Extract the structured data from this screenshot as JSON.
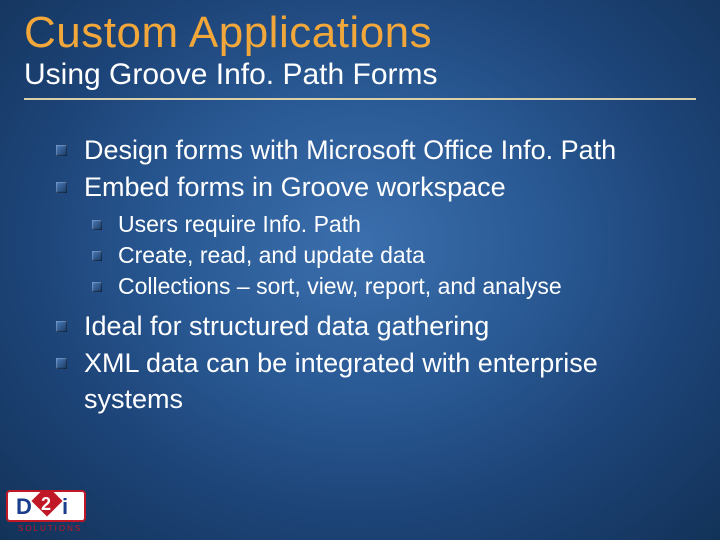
{
  "title": "Custom Applications",
  "subtitle": "Using Groove Info. Path Forms",
  "bullets": {
    "b0": "Design forms with Microsoft Office Info. Path",
    "b1": "Embed forms in Groove workspace",
    "b1_sub": {
      "s0": "Users require Info. Path",
      "s1": "Create, read, and update data",
      "s2": "Collections – sort, view, report, and analyse"
    },
    "b2": "Ideal for structured data gathering",
    "b3": "XML data can be integrated with enterprise systems"
  },
  "logo": {
    "top_text": "D",
    "mid_text": "2",
    "right_text": "i",
    "tagline": "SOLUTIONS"
  },
  "colors": {
    "accent": "#f2a73a",
    "rule": "#d9cfa8"
  }
}
